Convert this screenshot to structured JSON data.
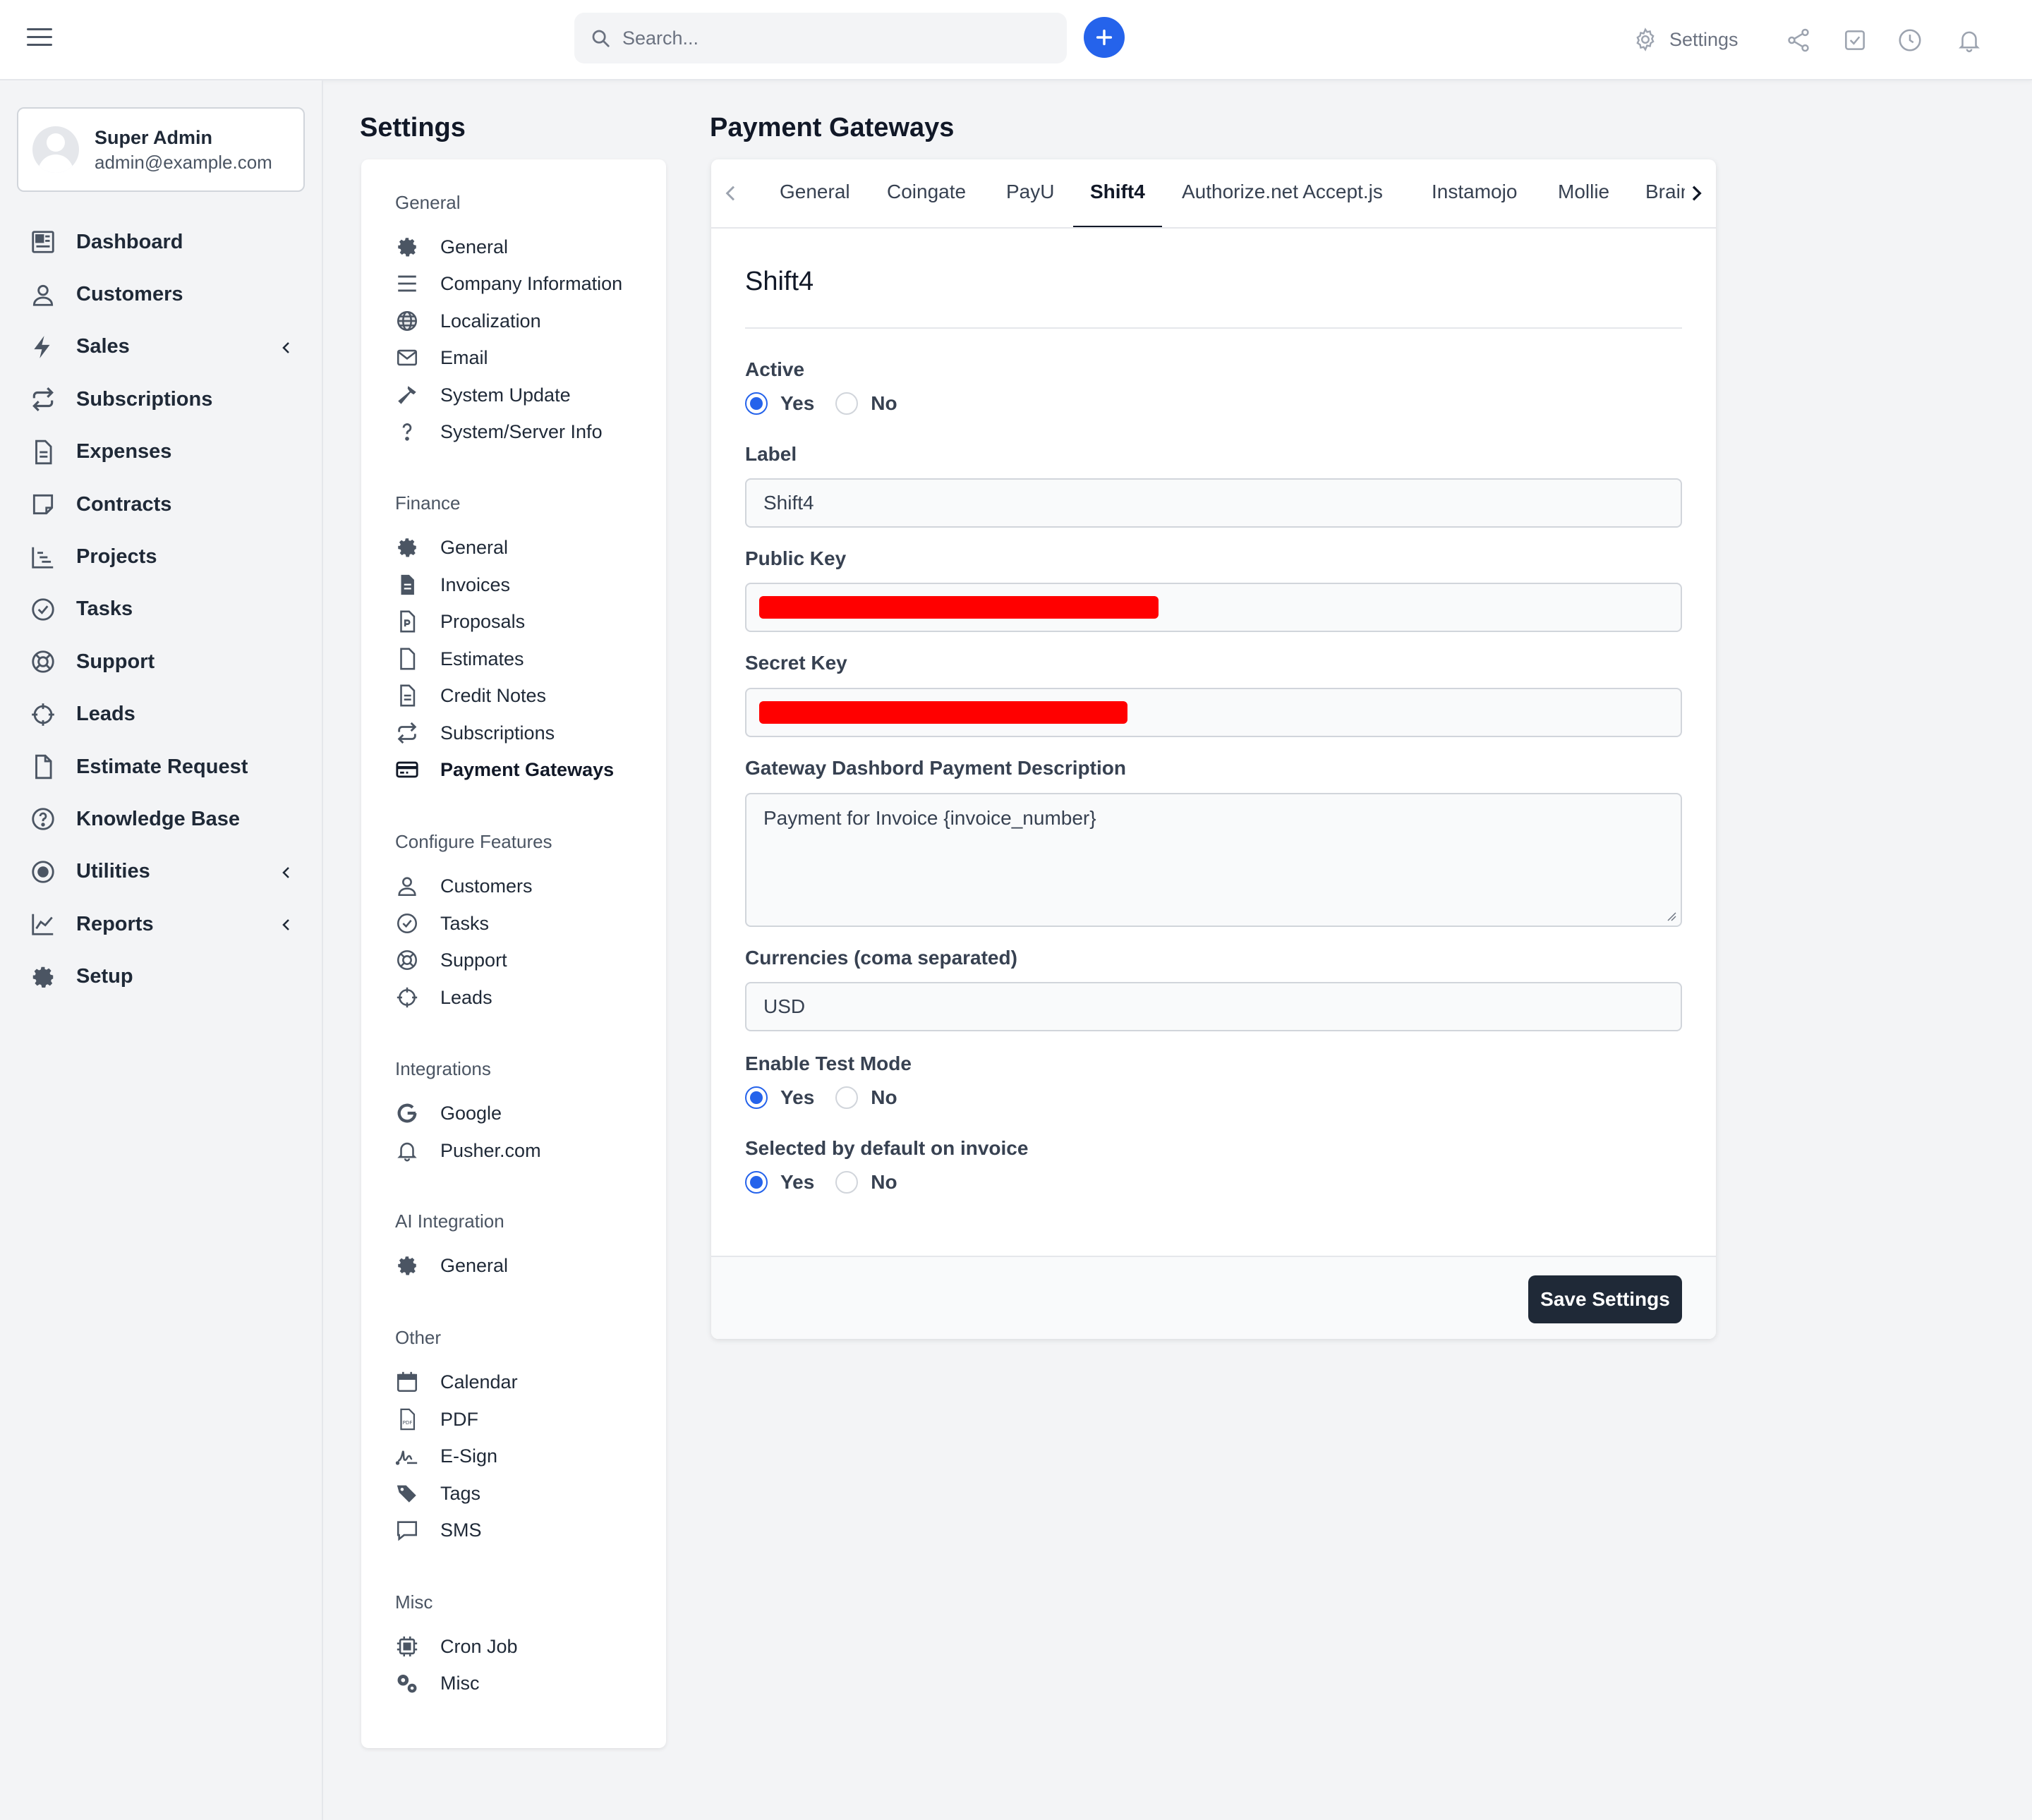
{
  "topbar": {
    "search_placeholder": "Search...",
    "settings_label": "Settings",
    "accent_color": "#2563eb"
  },
  "profile": {
    "name": "Super Admin",
    "email": "admin@example.com"
  },
  "nav": {
    "items": [
      {
        "label": "Dashboard",
        "icon": "dashboard-icon"
      },
      {
        "label": "Customers",
        "icon": "user-icon"
      },
      {
        "label": "Sales",
        "icon": "bolt-icon",
        "has_submenu": true
      },
      {
        "label": "Subscriptions",
        "icon": "repeat-icon"
      },
      {
        "label": "Expenses",
        "icon": "document-icon"
      },
      {
        "label": "Contracts",
        "icon": "contract-icon"
      },
      {
        "label": "Projects",
        "icon": "chart-bar-icon"
      },
      {
        "label": "Tasks",
        "icon": "check-circle-icon"
      },
      {
        "label": "Support",
        "icon": "lifebuoy-icon"
      },
      {
        "label": "Leads",
        "icon": "crosshair-icon"
      },
      {
        "label": "Estimate Request",
        "icon": "file-icon"
      },
      {
        "label": "Knowledge Base",
        "icon": "question-circle-icon"
      },
      {
        "label": "Utilities",
        "icon": "dot-circle-icon",
        "has_submenu": true
      },
      {
        "label": "Reports",
        "icon": "line-chart-icon",
        "has_submenu": true
      },
      {
        "label": "Setup",
        "icon": "gear-icon"
      }
    ]
  },
  "settings": {
    "title": "Settings",
    "sections": [
      {
        "heading": "General",
        "items": [
          "General",
          "Company Information",
          "Localization",
          "Email",
          "System Update",
          "System/Server Info"
        ]
      },
      {
        "heading": "Finance",
        "items": [
          "General",
          "Invoices",
          "Proposals",
          "Estimates",
          "Credit Notes",
          "Subscriptions",
          "Payment Gateways"
        ]
      },
      {
        "heading": "Configure Features",
        "items": [
          "Customers",
          "Tasks",
          "Support",
          "Leads"
        ]
      },
      {
        "heading": "Integrations",
        "items": [
          "Google",
          "Pusher.com"
        ]
      },
      {
        "heading": "AI Integration",
        "items": [
          "General"
        ]
      },
      {
        "heading": "Other",
        "items": [
          "Calendar",
          "PDF",
          "E-Sign",
          "Tags",
          "SMS"
        ]
      },
      {
        "heading": "Misc",
        "items": [
          "Cron Job",
          "Misc"
        ]
      }
    ],
    "active_item": "Payment Gateways"
  },
  "main": {
    "title": "Payment Gateways",
    "tabs": [
      "General",
      "Coingate",
      "PayU",
      "Shift4",
      "Authorize.net Accept.js",
      "Instamojo",
      "Mollie",
      "Braintree"
    ],
    "active_tab": "Shift4",
    "gateway_title": "Shift4",
    "form": {
      "active_label": "Active",
      "active_value": "Yes",
      "yes_label": "Yes",
      "no_label": "No",
      "label_label": "Label",
      "label_value": "Shift4",
      "public_key_label": "Public Key",
      "secret_key_label": "Secret Key",
      "description_label": "Gateway Dashbord Payment Description",
      "description_value": "Payment for Invoice {invoice_number}",
      "currencies_label": "Currencies (coma separated)",
      "currencies_value": "USD",
      "test_mode_label": "Enable Test Mode",
      "test_mode_value": "Yes",
      "default_label": "Selected by default on invoice",
      "default_value": "Yes",
      "redaction_color": "#ff0000"
    },
    "save_label": "Save Settings"
  }
}
